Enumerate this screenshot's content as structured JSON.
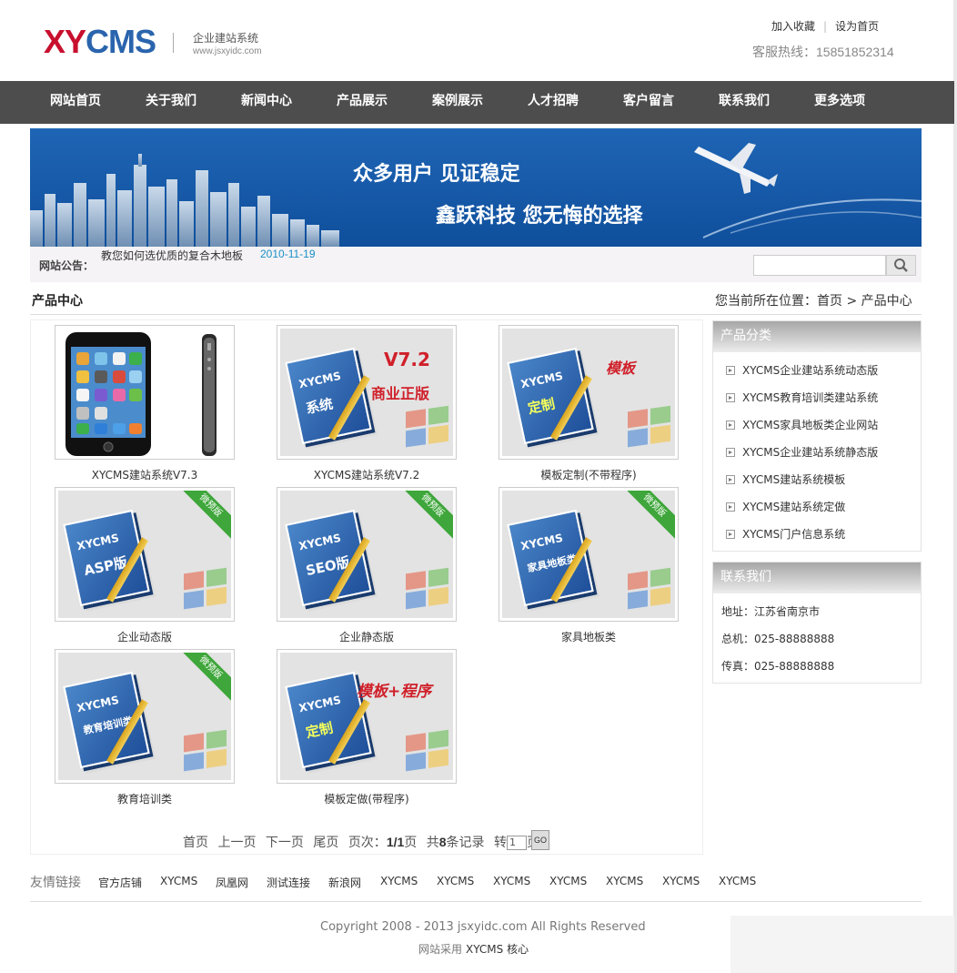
{
  "header": {
    "logo_xy": "XY",
    "logo_cms": "CMS",
    "logo_subtitle": "企业建站系统",
    "logo_url": "www.jsxyidc.com",
    "top_links": [
      "加入收藏",
      "设为首页"
    ],
    "hotline_label": "客服热线：",
    "hotline_number": "15851852314"
  },
  "nav": [
    "网站首页",
    "关于我们",
    "新闻中心",
    "产品展示",
    "案例展示",
    "人才招聘",
    "客户留言",
    "联系我们",
    "更多选项"
  ],
  "banner": {
    "line1": "众多用户  见证稳定",
    "line2": "鑫跃科技  您无悔的选择"
  },
  "notice": {
    "label": "网站公告：",
    "text": "教您如何选优质的复合木地板",
    "date": "2010-11-19"
  },
  "search": {
    "placeholder": "",
    "icon": "search-icon"
  },
  "breadcrumb": {
    "title": "产品中心",
    "path": "您当前所在位置：首页 > 产品中心"
  },
  "products": [
    {
      "caption": "XYCMS建站系统V7.3",
      "art": "phone"
    },
    {
      "caption": "XYCMS建站系统V7.2",
      "art": "book",
      "book_label": "系统",
      "red1": "V7.2",
      "red2": "商业正版"
    },
    {
      "caption": "模板定制(不带程序)",
      "art": "book",
      "book_label": "定制",
      "red1": "模板"
    },
    {
      "caption": "企业动态版",
      "art": "book",
      "book_label": "ASP版",
      "ribbon": "微预版"
    },
    {
      "caption": "企业静态版",
      "art": "book",
      "book_label": "SEO版",
      "ribbon": "微预版"
    },
    {
      "caption": "家具地板类",
      "art": "book",
      "book_label": "家具地板类",
      "ribbon": "微预版"
    },
    {
      "caption": "教育培训类",
      "art": "book",
      "book_label": "教育培训类",
      "ribbon": "微预版"
    },
    {
      "caption": "模板定做(带程序)",
      "art": "book",
      "book_label": "定制",
      "red1": "模板+程序"
    }
  ],
  "book_brand": "XYCMS",
  "pager": {
    "first": "首页",
    "prev": "上一页",
    "next": "下一页",
    "last": "尾页",
    "pages_label": "页次：",
    "pages_value": "1/1",
    "pages_unit": "页",
    "total_prefix": "共",
    "total_value": "8",
    "total_suffix": "条记录",
    "goto_label": "转",
    "goto_value": "1",
    "goto_unit": "页",
    "go": "GO"
  },
  "sidebar": {
    "category_title": "产品分类",
    "categories": [
      "XYCMS企业建站系统动态版",
      "XYCMS教育培训类建站系统",
      "XYCMS家具地板类企业网站",
      "XYCMS企业建站系统静态版",
      "XYCMS建站系统模板",
      "XYCMS建站系统定做",
      "XYCMS门户信息系统"
    ],
    "contact_title": "联系我们",
    "contact": [
      "地址：江苏省南京市",
      "总机：025-88888888",
      "传真：025-88888888"
    ]
  },
  "friend_links": {
    "label": "友情链接",
    "items": [
      "官方店铺",
      "XYCMS",
      "凤凰网",
      "测试连接",
      "新浪网",
      "XYCMS",
      "XYCMS",
      "XYCMS",
      "XYCMS",
      "XYCMS",
      "XYCMS",
      "XYCMS"
    ]
  },
  "footer": {
    "copyright": "Copyright 2008 - 2013 jsxyidc.com All Rights Reserved",
    "powered_prefix": "网站采用",
    "powered_name": "XYCMS 核心"
  },
  "colors": {
    "nav_bg": "#4d4d4d",
    "banner_blue": "#1a5eae",
    "logo_red": "#c8102e",
    "logo_blue": "#2a64ad",
    "date_link": "#1a8fc6"
  }
}
